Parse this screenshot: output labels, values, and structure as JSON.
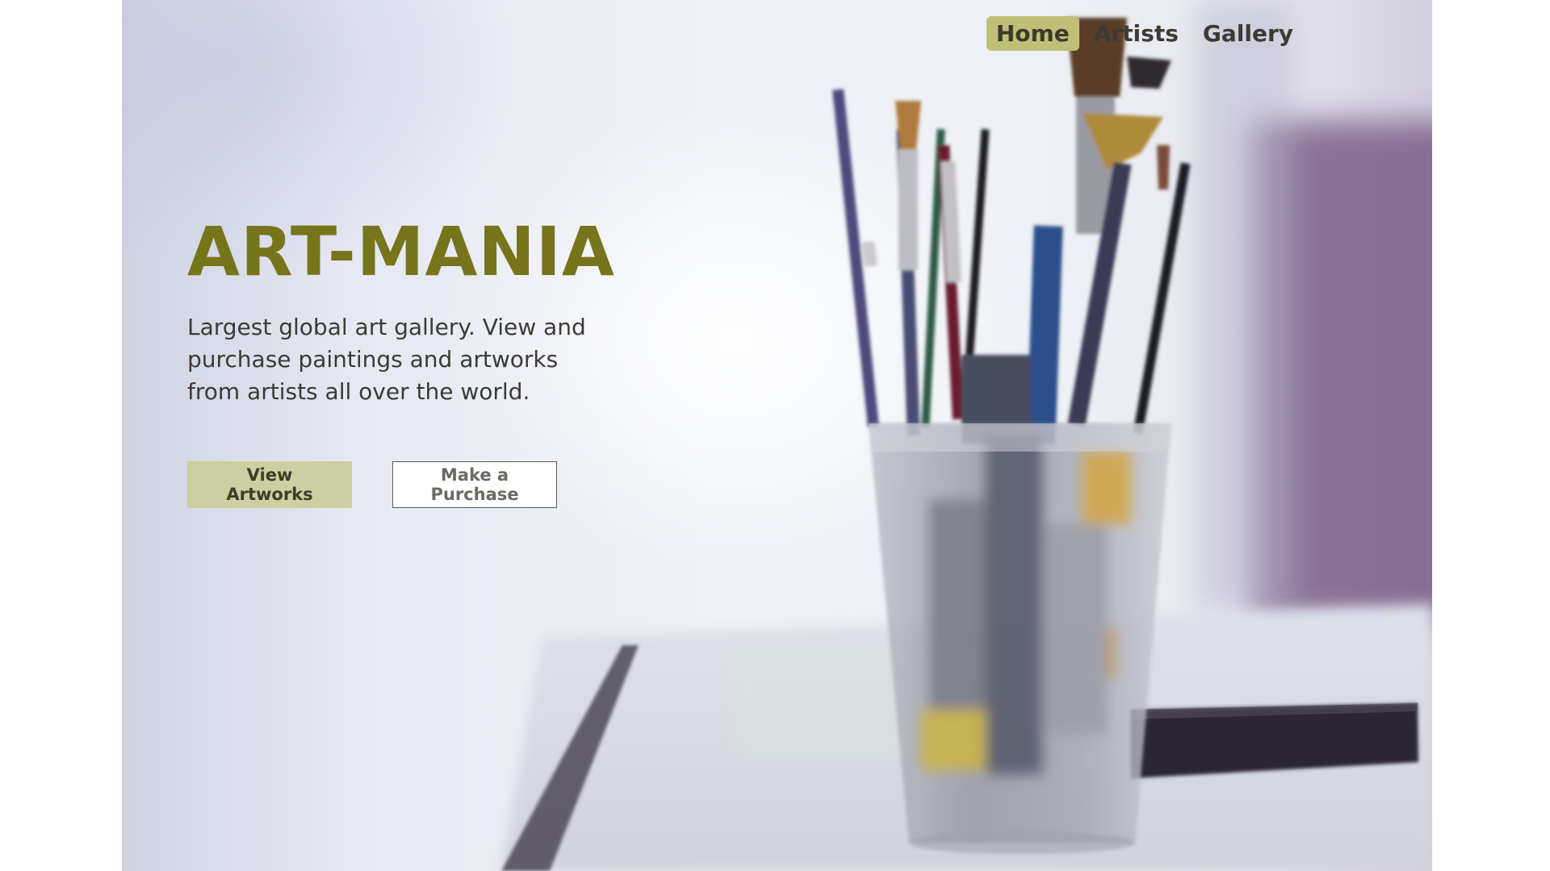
{
  "nav": {
    "items": [
      {
        "label": "Home",
        "active": true
      },
      {
        "label": "Artists",
        "active": false
      },
      {
        "label": "Gallery",
        "active": false
      }
    ]
  },
  "hero": {
    "title": "ART-MANIA",
    "description": "Largest global art gallery. View and purchase paintings and artworks from artists all over the world.",
    "primary_cta": "View Artworks",
    "secondary_cta": "Make a Purchase",
    "background_image": "paintbrushes-in-frosted-glass"
  },
  "colors": {
    "accent": "#76751b",
    "nav_active_bg": "#bfbf78",
    "primary_button_bg": "#cccf9f"
  }
}
